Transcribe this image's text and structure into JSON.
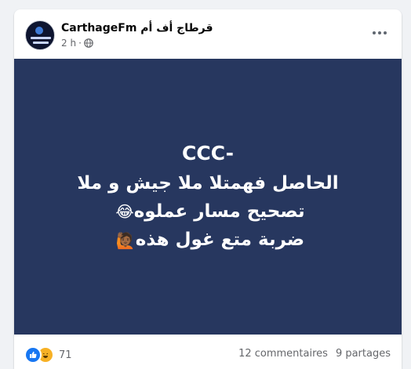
{
  "post": {
    "page_name": "CarthageFm قرطاج أف أم",
    "time": "2 h",
    "privacy_icon": "globe-icon",
    "more_icon": "more-options-icon"
  },
  "image_text": {
    "line1": "CCC-",
    "line2": "الحاصل فهمتلا ملا جيش و ملا",
    "line3": "تصحيح مسار عملوه",
    "line3_emoji": "😂",
    "line4": "ضربة متع غول هذه",
    "line4_emoji": "🙋🏾"
  },
  "footer": {
    "reaction_icons": [
      "like-icon",
      "haha-icon"
    ],
    "reaction_count": "71",
    "comments": "12 commentaires",
    "shares": "9 partages"
  },
  "colors": {
    "image_background": "#27375f",
    "like": "#1877f2",
    "haha": "#f7b125"
  }
}
